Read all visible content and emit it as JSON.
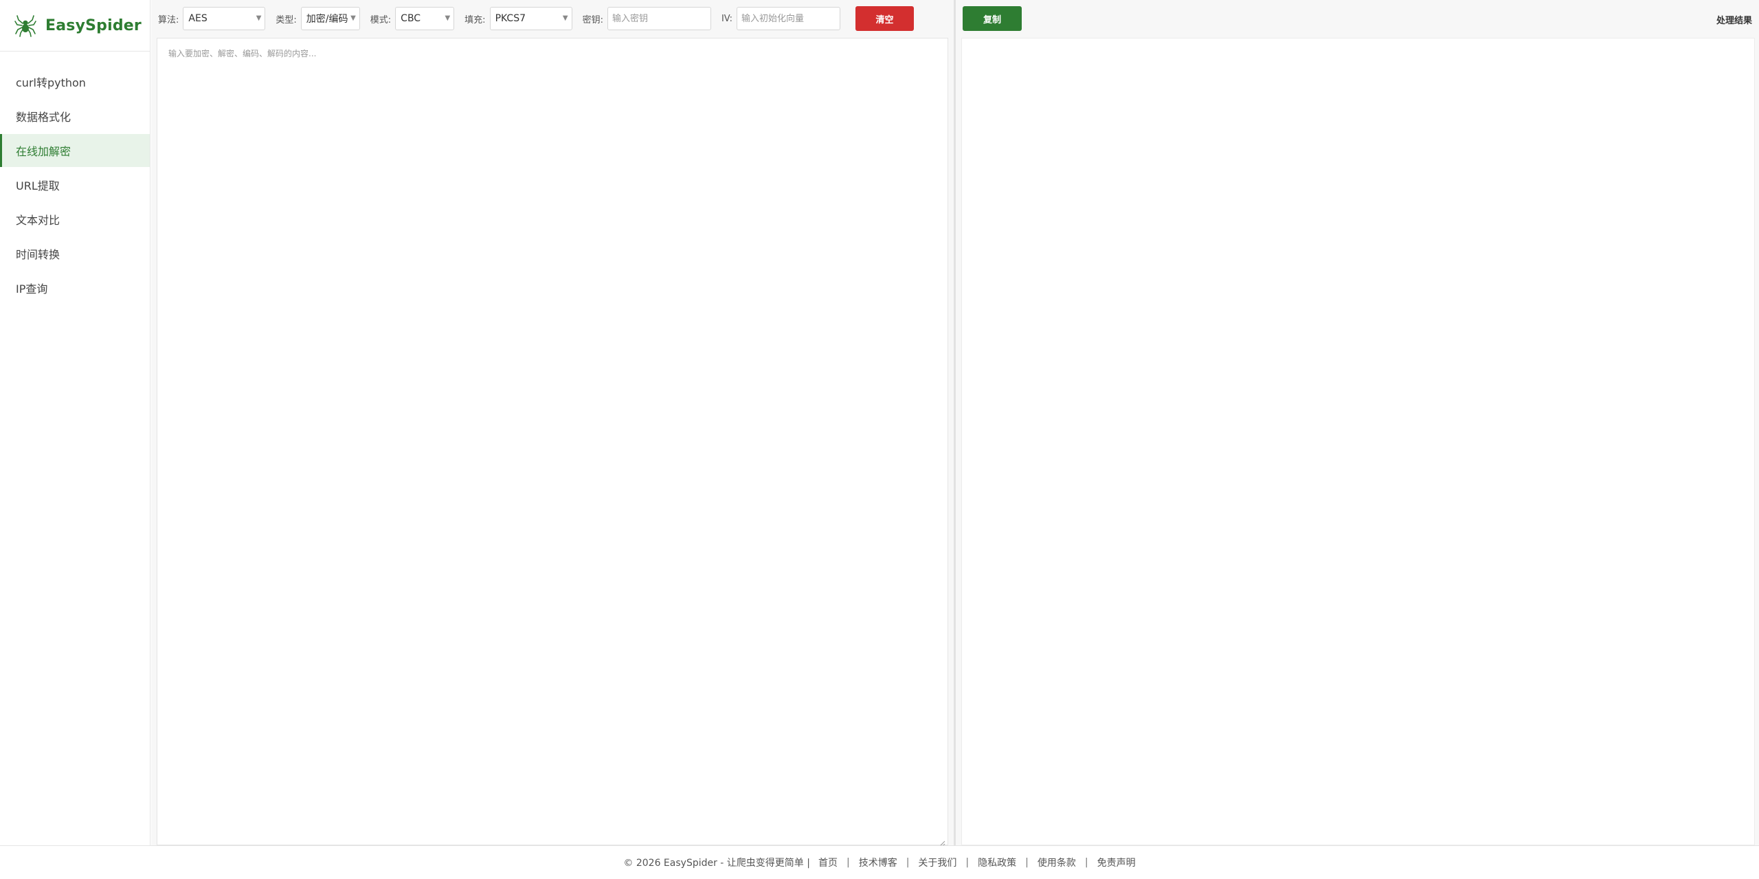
{
  "brand": {
    "name": "EasySpider",
    "logo_icon": "spider-icon",
    "color": "#2e7d32"
  },
  "sidebar": {
    "items": [
      {
        "label": "curl转python",
        "active": false
      },
      {
        "label": "数据格式化",
        "active": false
      },
      {
        "label": "在线加解密",
        "active": true
      },
      {
        "label": "URL提取",
        "active": false
      },
      {
        "label": "文本对比",
        "active": false
      },
      {
        "label": "时间转换",
        "active": false
      },
      {
        "label": "IP查询",
        "active": false
      }
    ]
  },
  "toolbar": {
    "algorithm_label": "算法:",
    "algorithm_value": "AES",
    "type_label": "类型:",
    "type_value": "加密/编码",
    "mode_label": "模式:",
    "mode_value": "CBC",
    "padding_label": "填充:",
    "padding_value": "PKCS7",
    "key_label": "密钥:",
    "key_placeholder": "输入密钥",
    "key_value": "",
    "iv_label": "IV:",
    "iv_placeholder": "输入初始化向量",
    "iv_value": "",
    "clear_label": "清空",
    "clear_color": "#d32f2f"
  },
  "input": {
    "placeholder": "输入要加密、解密、编码、解码的内容...",
    "value": ""
  },
  "output_panel": {
    "copy_label": "复制",
    "copy_color": "#2e7d32",
    "title": "处理结果",
    "value": ""
  },
  "footer": {
    "copyright": "© 2026 EasySpider - 让爬虫变得更简单 |",
    "links": [
      "首页",
      "技术博客",
      "关于我们",
      "隐私政策",
      "使用条款",
      "免责声明"
    ],
    "separator": "|"
  }
}
